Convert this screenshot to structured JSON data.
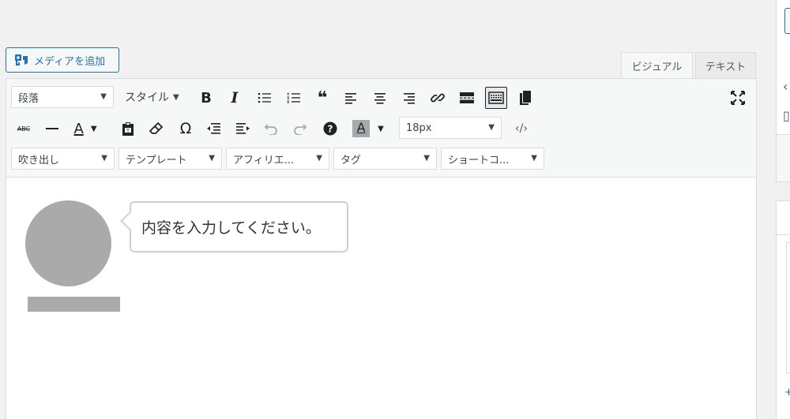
{
  "media_button": {
    "label": "メディアを追加",
    "icon": "media-icon"
  },
  "tabs": {
    "visual": "ビジュアル",
    "text": "テキスト"
  },
  "toolbar": {
    "row1": {
      "format_select": "段落",
      "style_select": "スタイル",
      "icons": [
        "bold-icon",
        "italic-icon",
        "bullet-list-icon",
        "numbered-list-icon",
        "blockquote-icon",
        "align-left-icon",
        "align-center-icon",
        "align-right-icon",
        "link-icon",
        "read-more-icon",
        "toolbar-toggle-icon",
        "copy-icon",
        "fullscreen-icon"
      ],
      "bold": "B",
      "italic": "I",
      "quote": "❝"
    },
    "row2": {
      "strike": "ABC",
      "text_color": "A",
      "omega": "Ω",
      "bg_color": "A",
      "font_size_select": "18px",
      "help": "?"
    },
    "row3": {
      "fukidashi_select": "吹き出し",
      "template_select": "テンプレート",
      "affiliate_select": "アフィリエ...",
      "tag_select": "タグ",
      "shortcode_select": "ショートコ..."
    }
  },
  "content": {
    "bubble_text": "内容を入力してください。"
  },
  "colors": {
    "accent": "#2271b1",
    "placeholder_gray": "#aaaaaa"
  }
}
